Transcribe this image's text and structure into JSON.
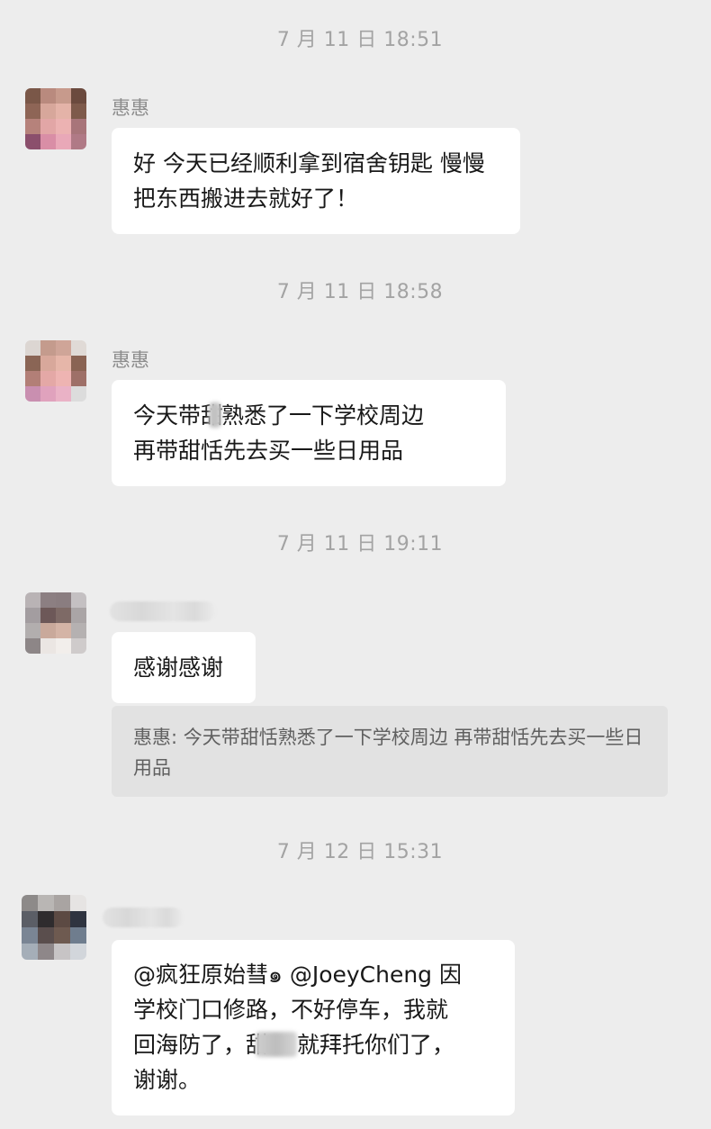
{
  "messages": [
    {
      "timestamp": "7 月 11 日 18:51",
      "sender": "惠惠",
      "text": "好 今天已经顺利拿到宿舍钥匙 慢慢把东西搬进去就好了！"
    },
    {
      "timestamp": "7 月 11 日 18:58",
      "sender": "惠惠",
      "text_part1": "今天带甜",
      "text_part2": "熟悉了一下学校周边",
      "text_part3": "再带甜恬先去买一些日用品"
    },
    {
      "timestamp": "7 月 11 日 19:11",
      "sender": "",
      "text": "感谢感谢",
      "quote": "惠惠: 今天带甜恬熟悉了一下学校周边 再带甜恬先去买一些日用品"
    },
    {
      "timestamp": "7 月 12 日 15:31",
      "sender": "",
      "line1": "@疯狂原始彗๑ @JoeyCheng 因",
      "line2": "学校门口修路，不好停车，我就",
      "line3a": "回海防了，甜",
      "line3b": "就拜托你们了，",
      "line4": "谢谢。"
    }
  ],
  "colors": {
    "background": "#ededed",
    "bubble": "#ffffff",
    "quote_bg": "#e2e2e2",
    "timestamp": "#a3a3a3",
    "sender": "#8c8c8c"
  }
}
